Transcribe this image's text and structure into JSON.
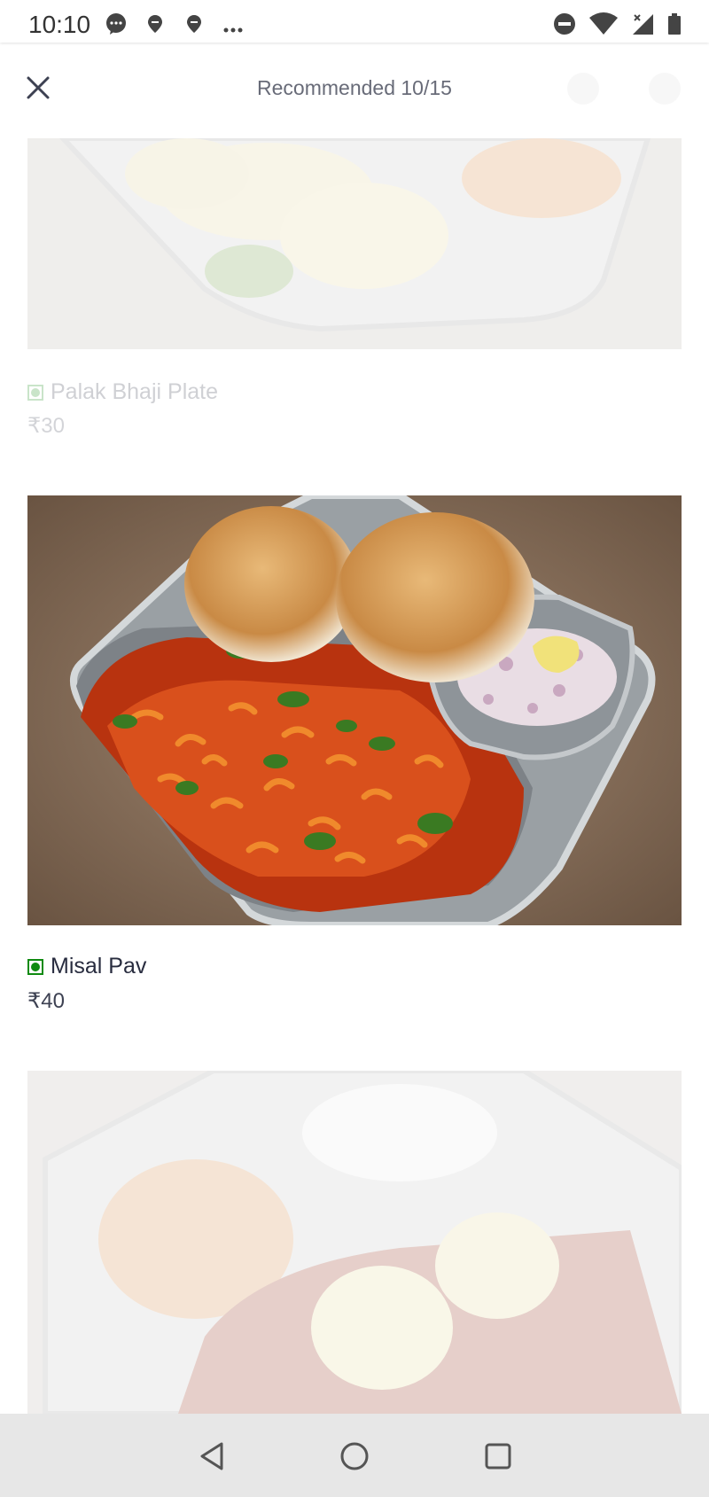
{
  "status_bar": {
    "time": "10:10",
    "left_icons": [
      "message-icon",
      "location-icon",
      "location-icon",
      "more-dots-icon"
    ],
    "right_icons": [
      "do-not-disturb-icon",
      "wifi-icon",
      "signal-icon",
      "battery-icon"
    ]
  },
  "header": {
    "title": "Recommended 10/15",
    "close_icon": "close-icon"
  },
  "items": [
    {
      "name": "Palak Bhaji Plate",
      "price": "₹30",
      "veg": true,
      "state": "faded"
    },
    {
      "name": "Misal Pav",
      "price": "₹40",
      "veg": true,
      "state": "active"
    },
    {
      "name": "",
      "price": "",
      "veg": true,
      "state": "faded"
    }
  ],
  "nav_bar": {
    "buttons": [
      "back-icon",
      "home-icon",
      "recents-icon"
    ]
  },
  "colors": {
    "veg_green": "#0f8a10",
    "title_gray": "#686b78",
    "text_dark": "#282c3f",
    "nav_bg": "#e7e7e7"
  }
}
